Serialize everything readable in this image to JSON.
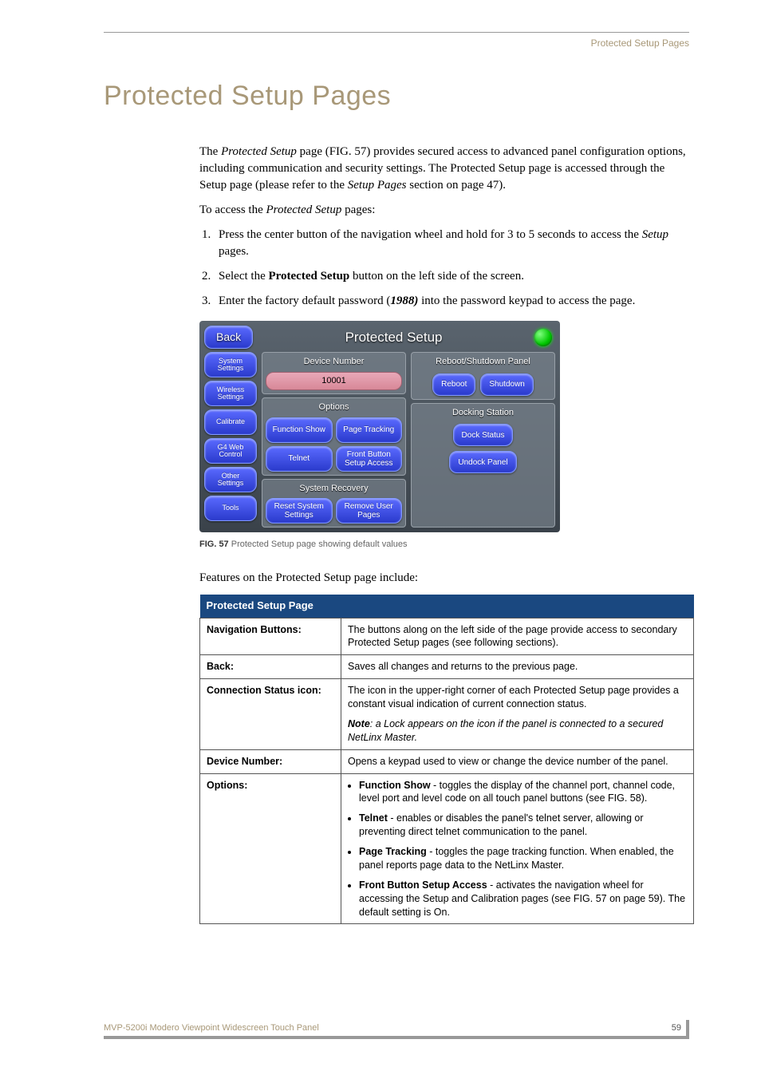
{
  "header": {
    "running_title": "Protected Setup Pages"
  },
  "title": "Protected Setup Pages",
  "intro": {
    "p1_a": "The ",
    "p1_b": "Protected Setup",
    "p1_c": " page (FIG. 57) provides secured access to advanced panel configuration options, including communication and security settings. The Protected Setup page is accessed through the Setup page (please refer to the ",
    "p1_d": "Setup Pages",
    "p1_e": " section on page 47).",
    "p2_a": "To access the ",
    "p2_b": "Protected Setup",
    "p2_c": " pages:"
  },
  "steps": {
    "s1_a": "Press the center button of the navigation wheel and hold for 3 to 5 seconds to access the ",
    "s1_b": "Setup",
    "s1_c": " pages.",
    "s2_a": "Select the ",
    "s2_b": "Protected Setup",
    "s2_c": " button on the left side of the screen.",
    "s3_a": "Enter the factory default password (",
    "s3_b": "1988)",
    "s3_c": " into the password keypad to access the page."
  },
  "panel": {
    "back": "Back",
    "title": "Protected Setup",
    "sidebar": [
      "System Settings",
      "Wireless Settings",
      "Calibrate",
      "G4 Web Control",
      "Other Settings",
      "Tools"
    ],
    "device_number_label": "Device Number",
    "device_number_value": "10001",
    "options_label": "Options",
    "opt_function_show": "Function Show",
    "opt_page_tracking": "Page Tracking",
    "opt_telnet": "Telnet",
    "opt_front_button": "Front Button Setup Access",
    "system_recovery_label": "System Recovery",
    "reset_system": "Reset System Settings",
    "remove_user": "Remove User Pages",
    "reboot_label": "Reboot/Shutdown Panel",
    "reboot": "Reboot",
    "shutdown": "Shutdown",
    "docking_label": "Docking Station",
    "dock_status": "Dock Status",
    "undock": "Undock Panel"
  },
  "caption": {
    "label": "FIG. 57",
    "text": "  Protected Setup page showing default values"
  },
  "features_intro": "Features on the Protected Setup page include:",
  "table": {
    "header": "Protected Setup Page",
    "rows": {
      "nav": {
        "label": "Navigation Buttons:",
        "desc": "The buttons along on the left side of the page provide access to secondary Protected Setup pages (see following sections)."
      },
      "back": {
        "label": "Back:",
        "desc": "Saves all changes and returns to the previous page."
      },
      "conn": {
        "label": "Connection Status icon:",
        "desc": "The icon in the upper-right corner of each Protected Setup page provides a constant visual indication of current connection status.",
        "note_label": "Note",
        "note_text": ": a Lock appears on the icon if the panel is connected to a secured NetLinx Master."
      },
      "devnum": {
        "label": "Device Number:",
        "desc": "Opens a keypad used to view or change the device number of the panel."
      },
      "options": {
        "label": "Options:",
        "bullets": {
          "fs_b": "Function Show",
          "fs_t": " - toggles the display of the channel port, channel code, level port and level code on all touch panel buttons (see FIG. 58).",
          "tn_b": "Telnet",
          "tn_t": " - enables or disables the panel's telnet server, allowing or preventing direct telnet communication to the panel.",
          "pt_b": "Page Tracking",
          "pt_t": " - toggles the page tracking function. When enabled, the panel reports page data to the NetLinx Master.",
          "fb_b": "Front Button Setup Access",
          "fb_t": " - activates the navigation wheel for accessing the Setup and Calibration pages (see FIG. 57 on page 59). The default setting is On."
        }
      }
    }
  },
  "footer": {
    "product": "MVP-5200i Modero Viewpoint Widescreen Touch Panel",
    "page": "59"
  }
}
